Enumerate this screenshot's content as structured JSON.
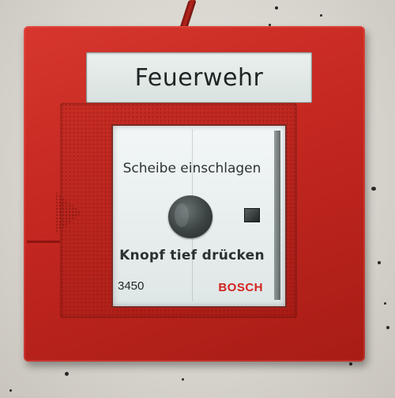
{
  "label_plate": {
    "text": "Feuerwehr"
  },
  "glass_panel": {
    "instruction_top": "Scheibe einschlagen",
    "instruction_bottom": "Knopf tief drücken",
    "model_number": "3450",
    "brand": "BOSCH"
  },
  "colors": {
    "housing_red": "#c32720",
    "brand_red": "#d1241d",
    "wall": "#d7d4cd",
    "glass": "#eaf0ee"
  }
}
